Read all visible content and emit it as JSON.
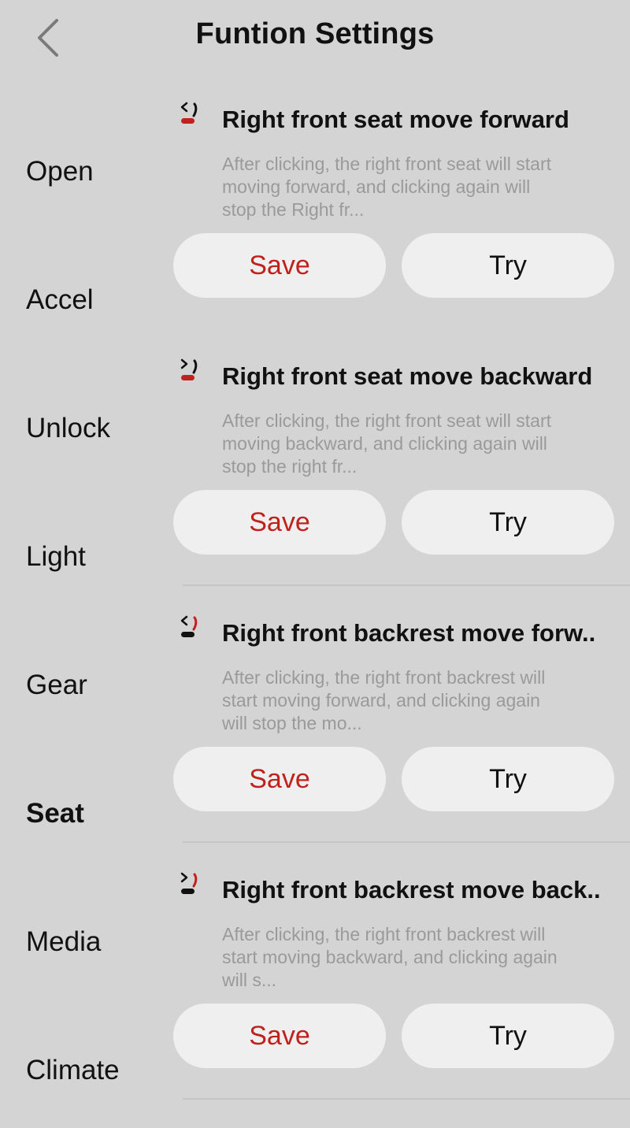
{
  "header": {
    "title": "Funtion Settings"
  },
  "sidebar": {
    "items": [
      {
        "label": "Open"
      },
      {
        "label": "Accel"
      },
      {
        "label": "Unlock"
      },
      {
        "label": "Light"
      },
      {
        "label": "Gear"
      },
      {
        "label": "Seat",
        "active": true
      },
      {
        "label": "Media"
      },
      {
        "label": "Climate"
      }
    ]
  },
  "functions": [
    {
      "icon": "seat-forward-icon",
      "title": "Right front seat move forward",
      "description": "After clicking, the right front seat will start moving forward, and clicking again will stop the Right fr...",
      "save_label": "Save",
      "try_label": "Try"
    },
    {
      "icon": "seat-backward-icon",
      "title": "Right front seat move backward",
      "description": "After clicking, the right front seat will start moving backward, and clicking again will stop the right fr...",
      "save_label": "Save",
      "try_label": "Try"
    },
    {
      "icon": "backrest-forward-icon",
      "title": "Right front backrest move forw..",
      "description": "After clicking, the right front backrest will start moving forward, and clicking again will stop the mo...",
      "save_label": "Save",
      "try_label": "Try"
    },
    {
      "icon": "backrest-backward-icon",
      "title": "Right front backrest move back..",
      "description": "After clicking, the right front backrest will start moving backward, and clicking again will s...",
      "save_label": "Save",
      "try_label": "Try"
    }
  ],
  "colors": {
    "background": "#d4d4d4",
    "button_bg": "#efefef",
    "accent_red": "#c0211d",
    "description_gray": "#9a9a9a"
  }
}
